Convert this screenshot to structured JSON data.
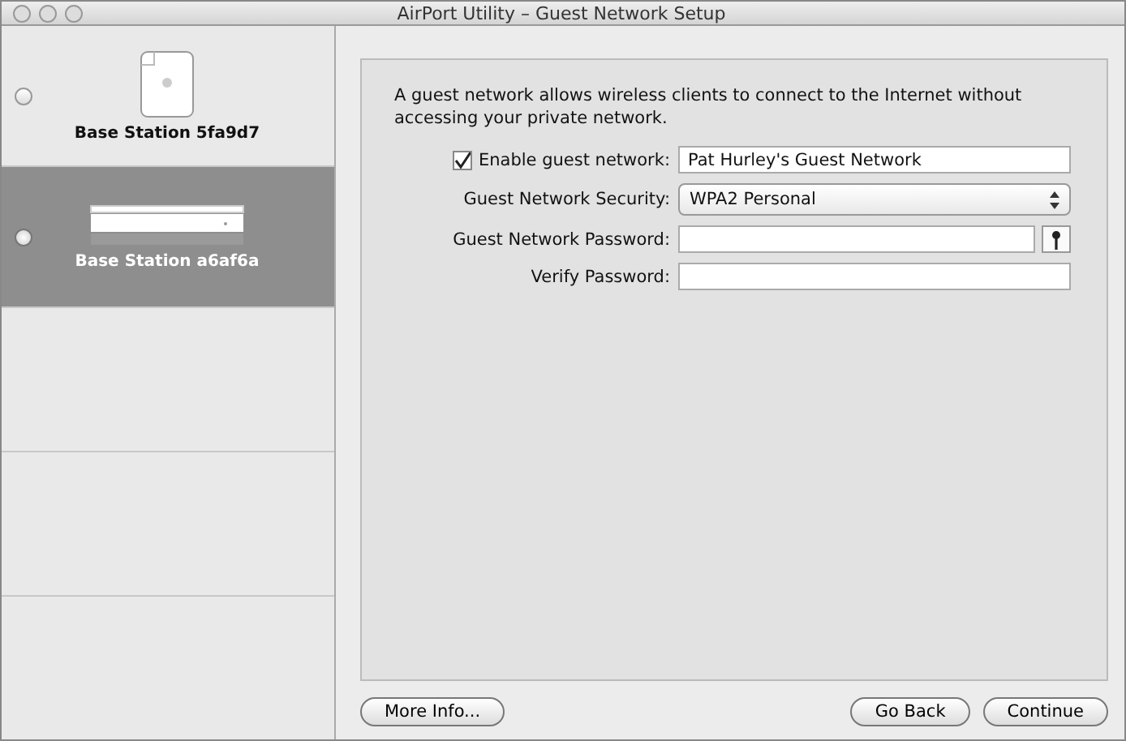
{
  "window": {
    "title": "AirPort Utility – Guest Network Setup"
  },
  "sidebar": {
    "items": [
      {
        "name": "Base Station 5fa9d7",
        "kind": "tower",
        "selected": false
      },
      {
        "name": "Base Station a6af6a",
        "kind": "flat",
        "selected": true
      }
    ]
  },
  "intro": "A guest network allows wireless clients to connect to the Internet without accessing your private network.",
  "form": {
    "enable": {
      "label": "Enable guest network:",
      "checked": true,
      "value": "Pat Hurley's Guest Network"
    },
    "security": {
      "label": "Guest Network Security:",
      "value": "WPA2 Personal"
    },
    "password": {
      "label": "Guest Network Password:"
    },
    "verify": {
      "label": "Verify Password:"
    }
  },
  "buttons": {
    "more": "More Info...",
    "back": "Go Back",
    "continue": "Continue"
  }
}
